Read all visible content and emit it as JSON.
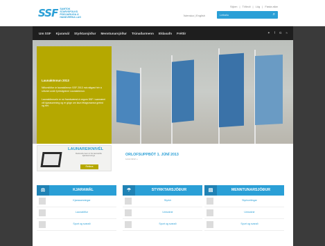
{
  "header": {
    "logo_mark": "SSF",
    "logo_text": "SAMTOK STARVSFOLKS FÍGGJARLIGA Á HANDVERKA LAG",
    "top_links": [
      "Stjórn",
      "Tíðindi",
      "Lög",
      "Fásta allar"
    ],
    "lang_links": [
      "Íslenska",
      "English"
    ],
    "search_placeholder": "Leitaðu",
    "search_icon": "search-icon"
  },
  "nav": {
    "items": [
      "Um SSF",
      "Kjaramál",
      "Styrktarsjóður",
      "Menntunarsjóður",
      "Trúnaðarmenn",
      "Eldasafn",
      "Fréttir"
    ],
    "social": [
      "twitter-icon",
      "facebook-icon",
      "google-icon",
      "rss-icon"
    ]
  },
  "hero": {
    "title": "Launakönnun 2013",
    "p1": "Niðurstöður úr launakönnun SSF 2013 má nálgast hér á síðunni undir fyrirsögninni Launakönnun.",
    "p2": "Launakönnunin er nú framkvæmd á vegum SSF í samræmi við kjarasamning og er gögn um laun félagsmanna greind og birt."
  },
  "banner": {
    "title": "LAUNAREIKNIVÉL",
    "subtitle": "Reiknaðu laun út frá launatöflu kjarasamnings",
    "button": "Reikna"
  },
  "news": {
    "title": "ORLOFSUPPBÓT 1. JÚNÍ 2013",
    "subtitle": "Lesa nánar »"
  },
  "columns": [
    {
      "title": "KJARAMÁL",
      "icon": "scales-icon",
      "rows": [
        "Kjarasamningar",
        "Launatöflur",
        "Spurt og svarað"
      ]
    },
    {
      "title": "STYRKTARSJÓÐUR",
      "icon": "umbrella-icon",
      "rows": [
        "Styrkir",
        "Umsóknir",
        "Spurt og svarað"
      ]
    },
    {
      "title": "MENNTUNARSJÓÐUR",
      "icon": "book-icon",
      "rows": [
        "Styrkveitingar",
        "Umsóknir",
        "Spurt og svarað"
      ]
    }
  ],
  "colors": {
    "accent": "#2a9fd6",
    "yellow": "#b5a800",
    "nav_bg": "#1e1e1e"
  }
}
